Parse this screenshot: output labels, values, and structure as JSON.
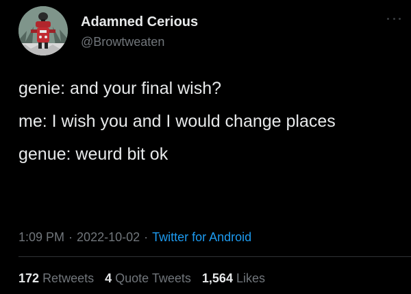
{
  "author": {
    "display_name": "Adamned Cerious",
    "handle": "@Browtweaten",
    "avatar_icon": "robot-avatar"
  },
  "tweet": {
    "lines": [
      "genie: and your final wish?",
      "me: I wish you and I would change places",
      "genue: weurd bit ok"
    ]
  },
  "meta": {
    "time": "1:09 PM",
    "separator": "·",
    "date": "2022-10-02",
    "source": "Twitter for Android"
  },
  "stats": {
    "retweets_count": "172",
    "retweets_label": "Retweets",
    "quote_count": "4",
    "quote_label": "Quote Tweets",
    "likes_count": "1,564",
    "likes_label": "Likes"
  },
  "colors": {
    "background": "#000000",
    "text": "#e7e9ea",
    "muted": "#71767b",
    "link": "#1d9bf0"
  }
}
